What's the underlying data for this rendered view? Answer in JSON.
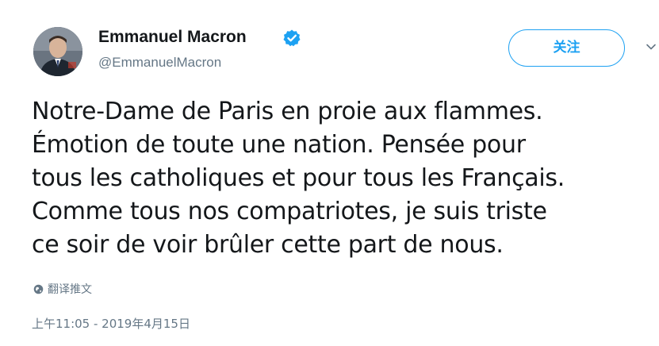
{
  "author": {
    "display_name": "Emmanuel Macron",
    "handle": "@EmmanuelMacron",
    "verified": true
  },
  "follow_button": {
    "label": "关注"
  },
  "tweet": {
    "lines": [
      "Notre-Dame de Paris en proie aux flammes.",
      "Émotion de toute une nation. Pensée pour",
      "tous les catholiques et pour tous les Français.",
      "Comme tous nos compatriotes, je suis triste",
      "ce soir de voir brûler cette part de nous."
    ],
    "translate_label": "翻译推文",
    "timestamp": "上午11:05 - 2019年4月15日"
  },
  "colors": {
    "accent": "#1da1f2",
    "text": "#14171a",
    "secondary_text": "#657786"
  },
  "icons": {
    "verified": "verified-badge-icon",
    "caret": "chevron-down-icon",
    "translate": "globe-icon"
  }
}
